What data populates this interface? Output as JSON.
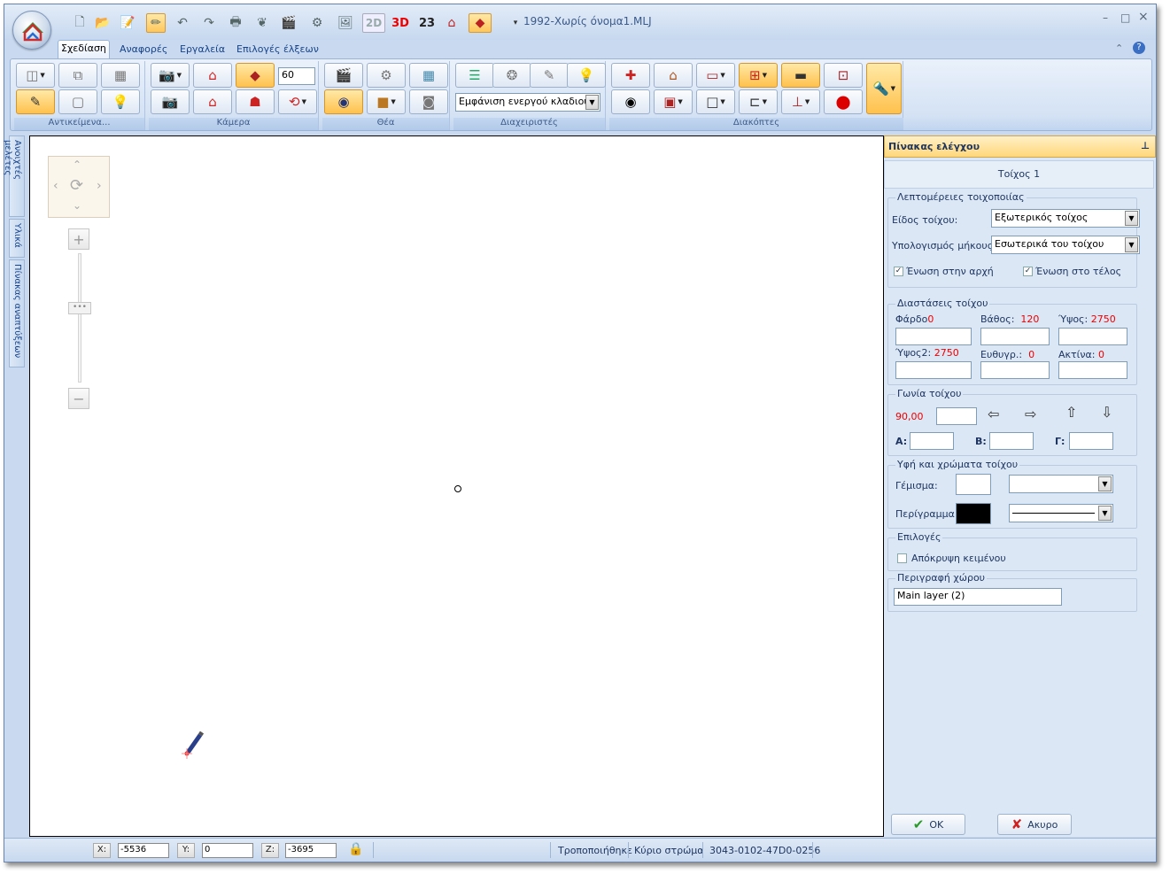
{
  "window": {
    "title": "1992-Χωρίς όνομα1.MLJ",
    "controls": [
      "–",
      "□",
      "×"
    ]
  },
  "qat": {
    "btn_2d": "2D",
    "btn_3d": "3D",
    "btn_23": "23"
  },
  "tabs": [
    "Σχεδίαση",
    "Αναφορές",
    "Εργαλεία",
    "Επιλογές έλξεων"
  ],
  "ribbon": {
    "groups": [
      "Αντικείμενα...",
      "Κάμερα",
      "Θέα",
      "Διαχειριστές",
      "Διακόπτες"
    ],
    "camera_value": "60",
    "branch_select": "Εμφάνιση ενεργού κλαδιού"
  },
  "side_tabs": [
    "Ανοιχτές μελέτες",
    "Υλικά",
    "Πίνακας αναπτύξεων"
  ],
  "panel": {
    "title": "Πίνακας ελέγχου",
    "pin": "⊥",
    "wall_name": "Τοίχος  1",
    "wallwork": {
      "legend": "Λεπτομέρειες τοιχοποιίας",
      "type_label": "Είδος τοίχου:",
      "type_value": "Εξωτερικός τοίχος",
      "length_label": "Υπολογισμός μήκους:",
      "length_value": "Εσωτερικά του τοίχου",
      "join_start": "Ένωση στην αρχή",
      "join_end": "Ένωση στο τέλος"
    },
    "dims": {
      "legend": "Διαστάσεις τοίχου",
      "load_label": "Φάρδο",
      "load_value": "0",
      "depth_label": "Βάθος:",
      "depth_value": "120",
      "height_label": "Ύψος:",
      "height_value": "2750",
      "height2_label": "Ύψος2:",
      "height2_value": "2750",
      "straight_label": "Ευθυγρ.:",
      "straight_value": "0",
      "radius_label": "Ακτίνα:",
      "radius_value": "0"
    },
    "angle": {
      "legend": "Γωνία τοίχου",
      "value": "90,00",
      "a_label": "A:",
      "b_label": "B:",
      "c_label": "Γ:"
    },
    "texture": {
      "legend": "Υφή και χρώματα τοίχου",
      "fill_label": "Γέμισμα:",
      "outline_label": "Περίγραμμα:",
      "fill_color": "#ffffff",
      "outline_color": "#000000"
    },
    "options": {
      "legend": "Επιλογές",
      "hide_text": "Απόκρυψη κειμένου"
    },
    "space": {
      "legend": "Περιγραφή χώρου",
      "value": "Main layer (2)"
    },
    "ok": "OK",
    "cancel": "Ακυρο"
  },
  "status": {
    "x_label": "X:",
    "x_value": "-5536",
    "y_label": "Y:",
    "y_value": "0",
    "z_label": "Z:",
    "z_value": "-3695",
    "modified": "Τροποποιήθηκε",
    "layer": "Κύριο στρώμα",
    "code": "3043-0102-47D0-0256"
  }
}
